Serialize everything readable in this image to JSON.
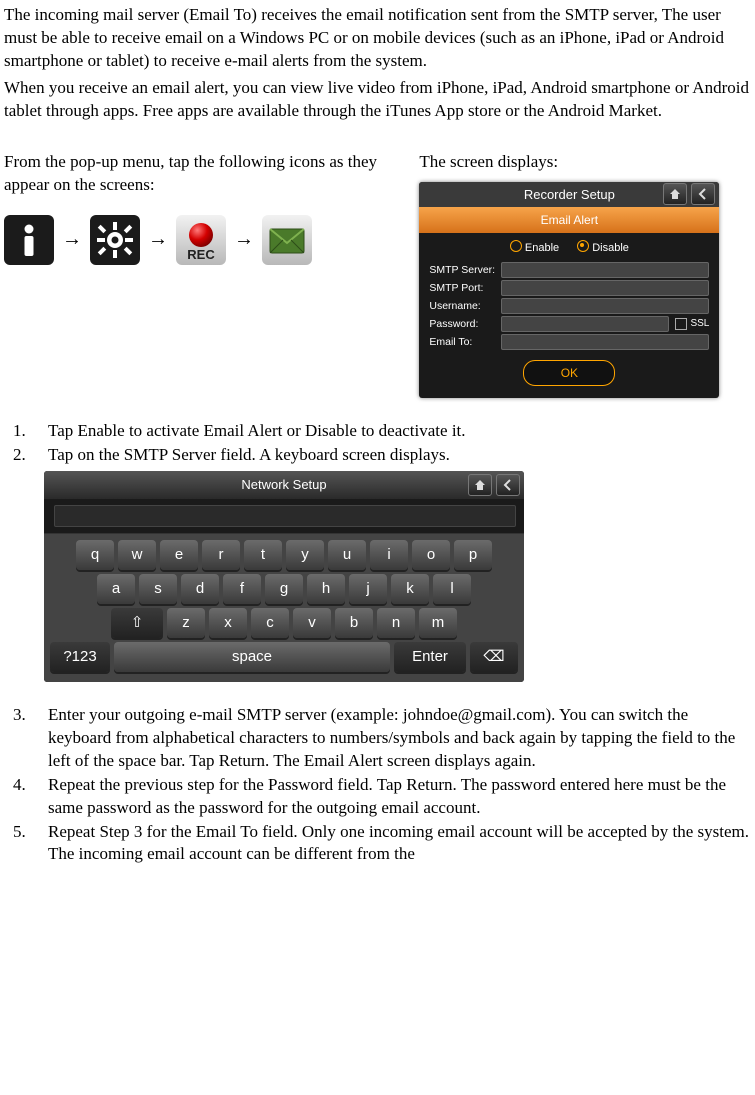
{
  "intro": {
    "p1": "The incoming mail server (Email To) receives the email notification sent from the SMTP server, The user must be able to receive email on a Windows PC or on mobile devices (such as an iPhone, iPad or Android smartphone or tablet) to receive e-mail alerts from the system.",
    "p2": "When you receive an email alert, you can view live video from iPhone, iPad, Android smartphone or Android tablet through apps. Free apps are available through the iTunes App store or the Android Market."
  },
  "columns": {
    "left_text": "From the pop-up menu, tap the following icons as they appear on the screens:",
    "right_text": "The screen displays:"
  },
  "arrow": "→",
  "icon_names": [
    "info-icon",
    "settings-icon",
    "alert-record-icon",
    "email-icon"
  ],
  "recorder_setup": {
    "title": "Recorder Setup",
    "tab": "Email Alert",
    "enable_label": "Enable",
    "disable_label": "Disable",
    "fields": {
      "smtp_server": "SMTP Server:",
      "smtp_port": "SMTP Port:",
      "username": "Username:",
      "password": "Password:",
      "email_to": "Email To:"
    },
    "ssl_label": "SSL",
    "ok_label": "OK"
  },
  "steps": {
    "s1": "Tap Enable to activate Email Alert or Disable to deactivate it.",
    "s2": "Tap on the SMTP Server field. A keyboard screen displays.",
    "s3": "Enter your outgoing e-mail SMTP server (example: johndoe@gmail.com). You can switch the keyboard from alphabetical characters to numbers/symbols and back again by tapping the field to the left of the space bar. Tap Return. The Email Alert screen displays again.",
    "s4": "Repeat the previous step for the Password field. Tap Return. The password entered here must be the same password as the password for the outgoing email account.",
    "s5": "Repeat Step 3 for the Email To field. Only one incoming email account will be accepted by the system. The incoming email account can be different from the"
  },
  "keyboard": {
    "title": "Network Setup",
    "rows": {
      "r1": [
        "q",
        "w",
        "e",
        "r",
        "t",
        "y",
        "u",
        "i",
        "o",
        "p"
      ],
      "r2": [
        "a",
        "s",
        "d",
        "f",
        "g",
        "h",
        "j",
        "k",
        "l"
      ],
      "r3": [
        "z",
        "x",
        "c",
        "v",
        "b",
        "n",
        "m"
      ]
    },
    "mode_key": "?123",
    "space_key": "space",
    "enter_key": "Enter",
    "shift_glyph": "⇧",
    "backspace_glyph": "⌫"
  }
}
